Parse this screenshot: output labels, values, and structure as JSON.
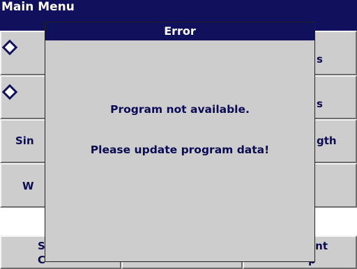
{
  "main_menu": {
    "title": "Main Menu",
    "left_buttons": [
      "",
      "",
      "Sin",
      "W"
    ],
    "right_buttons": [
      "s",
      "s",
      "gth",
      ""
    ],
    "bottom_left_lines": "S\nC",
    "bottom_right_lines": "ent\np"
  },
  "error_dialog": {
    "title": "Error",
    "message_line1": "Program not available.",
    "message_line2": "Please update program data!"
  },
  "colors": {
    "title_bar": "#10105c",
    "background": "#cdcdcd",
    "text": "#0b0b55"
  }
}
